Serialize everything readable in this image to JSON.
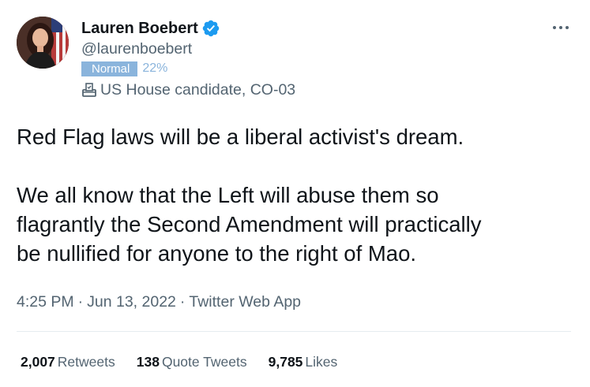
{
  "author": {
    "display_name": "Lauren Boebert",
    "handle": "@laurenboebert",
    "badge_label": "Normal",
    "badge_percent": "22%",
    "account_label": "US House candidate, CO-03",
    "verified": true
  },
  "tweet": {
    "paragraphs": [
      "Red Flag laws will be a liberal activist's dream.",
      "We all know that the Left will abuse them so\nflagrantly the Second Amendment will practically\nbe nullified for anyone to the right of Mao."
    ]
  },
  "meta": {
    "time": "4:25 PM",
    "separator": "·",
    "date": "Jun 13, 2022",
    "source": "Twitter Web App"
  },
  "stats": {
    "retweets_count": "2,007",
    "retweets_label": "Retweets",
    "quotes_count": "138",
    "quotes_label": "Quote Tweets",
    "likes_count": "9,785",
    "likes_label": "Likes"
  },
  "colors": {
    "verified_blue": "#1d9bf0",
    "badge_blue": "#8ab4dc",
    "secondary_text": "#536471",
    "primary_text": "#0f1419"
  },
  "icons": {
    "verified": "verified-badge-icon",
    "ballot": "ballot-box-icon",
    "more": "more-horizontal-icon"
  }
}
